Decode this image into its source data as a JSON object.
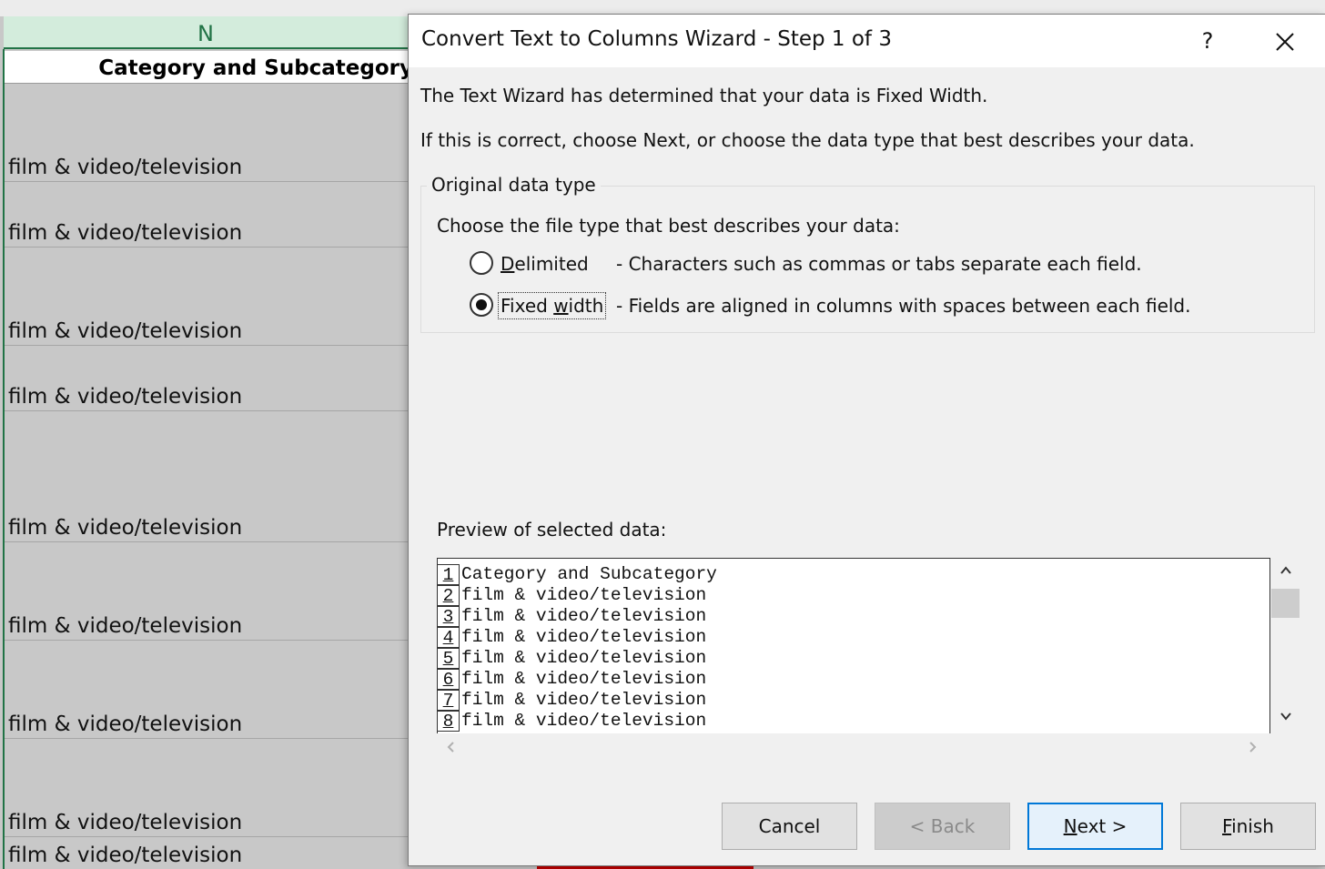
{
  "sheet": {
    "column_letter": "N",
    "header_cell": "Category and Subcategory",
    "cells": [
      "film & video/television",
      "film & video/television",
      "film & video/television",
      "film & video/television",
      "film & video/television",
      "film & video/television",
      "film & video/television",
      "film & video/television",
      "film & video/television"
    ]
  },
  "dialog": {
    "title": "Convert Text to Columns Wizard - Step 1 of 3",
    "help_label": "?",
    "intro_line1": "The Text Wizard has determined that your data is Fixed Width.",
    "intro_line2": "If this is correct, choose Next, or choose the data type that best describes your data.",
    "group_title": "Original data type",
    "group_prompt": "Choose the file type that best describes your data:",
    "options": [
      {
        "label_accel": "D",
        "label_rest": "elimited",
        "description": "- Characters such as commas or tabs separate each field.",
        "selected": false
      },
      {
        "label_pre": "Fixed ",
        "label_accel": "w",
        "label_rest": "idth",
        "description": "- Fields are aligned in columns with spaces between each field.",
        "selected": true
      }
    ],
    "preview_label": "Preview of selected data:",
    "preview_lines": [
      {
        "num": "1",
        "text": "Category and Subcategory"
      },
      {
        "num": "2",
        "text": "film & video/television"
      },
      {
        "num": "3",
        "text": "film & video/television"
      },
      {
        "num": "4",
        "text": "film & video/television"
      },
      {
        "num": "5",
        "text": "film & video/television"
      },
      {
        "num": "6",
        "text": "film & video/television"
      },
      {
        "num": "7",
        "text": "film & video/television"
      },
      {
        "num": "8",
        "text": "film & video/television"
      }
    ],
    "buttons": {
      "cancel": "Cancel",
      "back": "< Back",
      "next_accel": "N",
      "next_rest": "ext >",
      "finish_accel": "F",
      "finish_rest": "inish"
    }
  },
  "colors": {
    "excel_green": "#217346",
    "header_green": "#d3ecdc",
    "focus_blue": "#0078d7",
    "selection_red": "#c00000"
  },
  "icons": [
    "close-icon",
    "scroll-up-icon",
    "scroll-down-icon",
    "scroll-left-icon",
    "scroll-right-icon"
  ]
}
